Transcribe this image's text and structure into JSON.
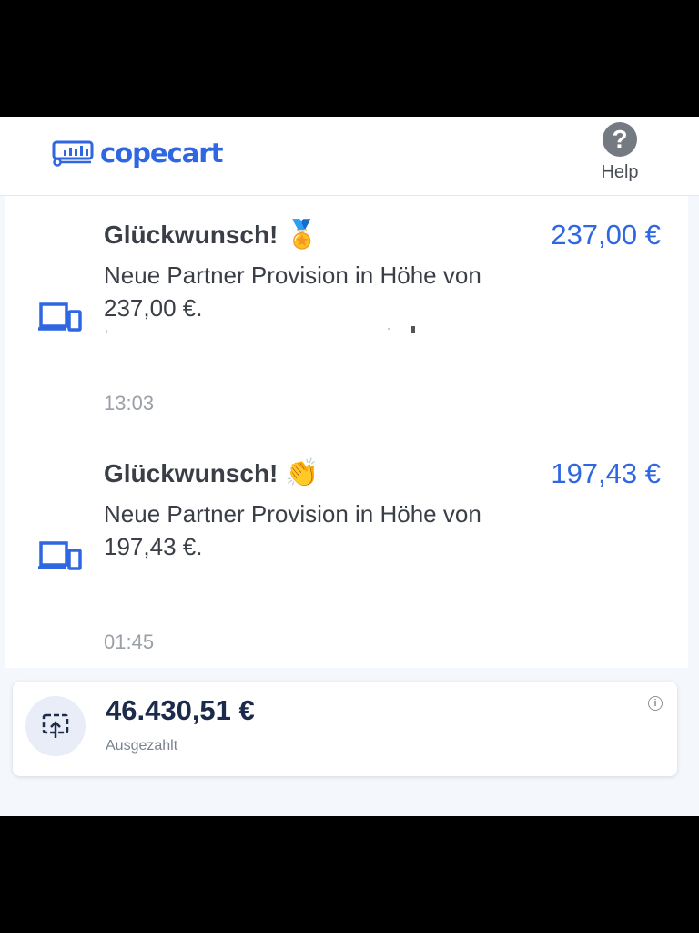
{
  "header": {
    "logo_text": "copecart",
    "help_label": "Help",
    "help_symbol": "?"
  },
  "notifications": [
    {
      "title": "Glückwunsch!",
      "emoji": "🏅",
      "emoji_name": "medal-icon",
      "message": "Neue Partner Provision in Höhe von 237,00 €.",
      "amount": "237,00  €",
      "time": "13:03"
    },
    {
      "title": "Glückwunsch!",
      "emoji": "👏",
      "emoji_name": "clapping-hands-icon",
      "message": "Neue Partner Provision in Höhe von 197,43 €.",
      "amount": "197,43  €",
      "time": "01:45"
    }
  ],
  "balance": {
    "amount": "46.430,51 €",
    "label": "Ausgezahlt",
    "info_symbol": "i"
  },
  "colors": {
    "brand_blue": "#2f66e2",
    "text_dark": "#3a3f47",
    "time_gray": "#9aa0a8",
    "balance_navy": "#1c2b4a"
  }
}
